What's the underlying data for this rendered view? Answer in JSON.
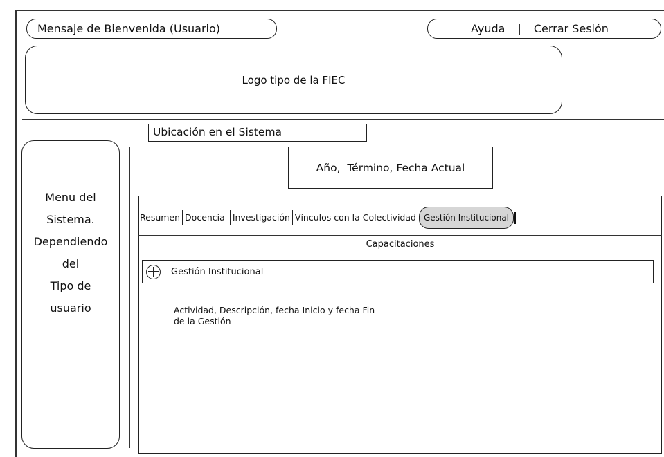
{
  "header": {
    "welcome_message": "Mensaje de Bienvenida (Usuario)",
    "help_link": "Ayuda",
    "separator": "|",
    "logout_link": "Cerrar Sesión"
  },
  "logo": {
    "text": "Logo tipo de la FIEC"
  },
  "breadcrumb": {
    "text": "Ubicación en el Sistema"
  },
  "date_info": {
    "text": "Año,  Término, Fecha Actual"
  },
  "sidebar": {
    "lines": [
      "Menu del",
      "Sistema.",
      "Dependiendo",
      "del",
      "Tipo de",
      "usuario"
    ]
  },
  "tabs": [
    {
      "label": "Resumen",
      "active": false
    },
    {
      "label": "Docencia",
      "active": false
    },
    {
      "label": "Investigación",
      "active": false
    },
    {
      "label": "Vínculos con la Colectividad",
      "active": false
    },
    {
      "label": "Gestión Institucional",
      "active": true
    }
  ],
  "content": {
    "section_title": "Capacitaciones",
    "expander_label": "Gestión Institucional",
    "description_line1": "Actividad, Descripción, fecha Inicio y fecha Fin",
    "description_line2": "de la Gestión"
  }
}
